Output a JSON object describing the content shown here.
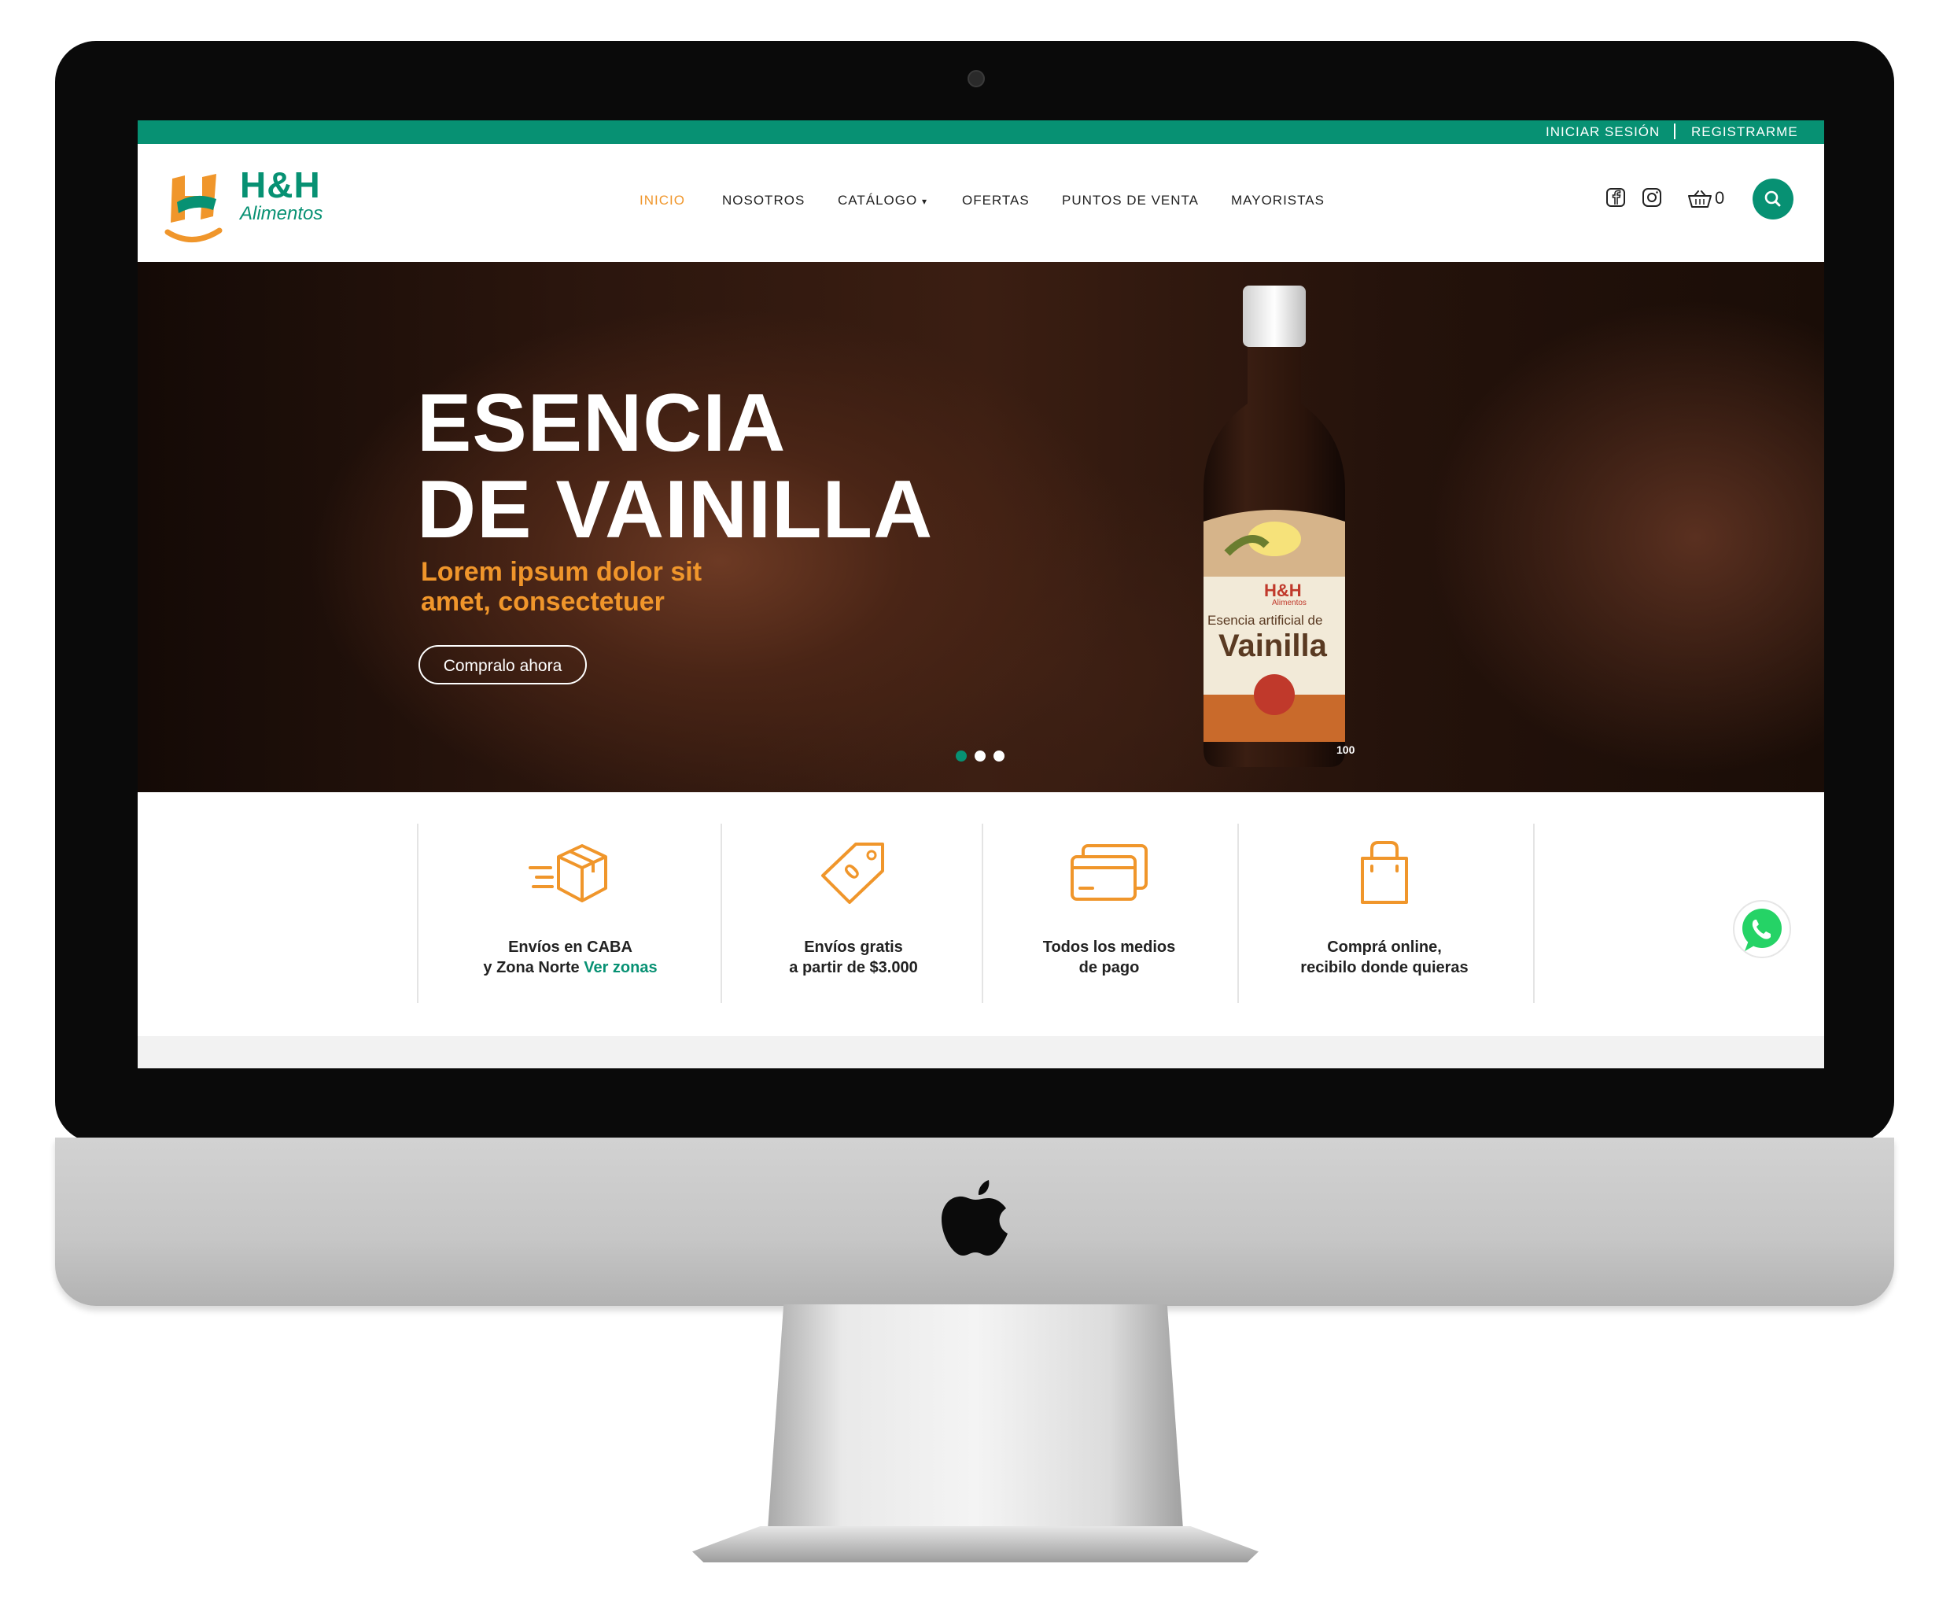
{
  "topbar": {
    "login": "INICIAR SESIÓN",
    "register": "REGISTRARME"
  },
  "brand": {
    "name": "H&H",
    "tagline": "Alimentos"
  },
  "nav": {
    "items": [
      {
        "label": "INICIO",
        "active": true
      },
      {
        "label": "NOSOTROS"
      },
      {
        "label": "CATÁLOGO"
      },
      {
        "label": "OFERTAS"
      },
      {
        "label": "PUNTOS DE VENTA"
      },
      {
        "label": "MAYORISTAS"
      }
    ],
    "cart_count": "0"
  },
  "hero": {
    "title_line1": "ESENCIA",
    "title_line2": "DE VAINILLA",
    "subtitle_line1": "Lorem ipsum dolor sit",
    "subtitle_line2": "amet, consectetuer",
    "cta": "Compralo ahora",
    "bottle": {
      "brand": "H&H",
      "brand_sub": "Alimentos",
      "line": "Esencia artificial de",
      "product": "Vainilla",
      "size": "100"
    },
    "slides_total": 3,
    "active_slide": 1
  },
  "features": [
    {
      "line1": "Envíos en CABA",
      "line2": "y Zona Norte",
      "link": "Ver zonas",
      "icon": "box-delivery-icon"
    },
    {
      "line1": "Envíos gratis",
      "line2": "a partir de $3.000",
      "icon": "price-tag-icon"
    },
    {
      "line1": "Todos los medios",
      "line2": "de pago",
      "icon": "credit-card-icon"
    },
    {
      "line1": "Comprá online,",
      "line2": "recibilo donde quieras",
      "icon": "shopping-bag-icon"
    }
  ],
  "colors": {
    "brand_green": "#079173",
    "accent_orange": "#f0962b"
  }
}
